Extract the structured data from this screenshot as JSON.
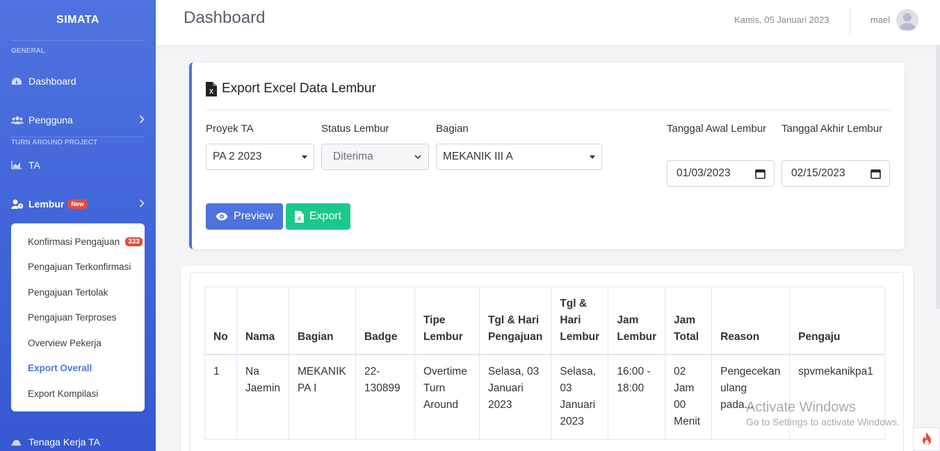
{
  "sidebar": {
    "brand": "SIMATA",
    "sections": {
      "general": "GENERAL",
      "tap": "TURN AROUND PROJECT"
    },
    "items": {
      "dashboard": "Dashboard",
      "pengguna": "Pengguna",
      "ta": "TA",
      "lembur": "Lembur",
      "lembur_badge": "New",
      "tenaga_kerja": "Tenaga Kerja TA"
    },
    "submenu": [
      {
        "label": "Konfirmasi Pengajuan",
        "badge": "333"
      },
      {
        "label": "Pengajuan Terkonfirmasi"
      },
      {
        "label": "Pengajuan Tertolak"
      },
      {
        "label": "Pengajuan Terproses"
      },
      {
        "label": "Overview Pekerja"
      },
      {
        "label": "Export Overall",
        "active": true
      },
      {
        "label": "Export Kompilasi"
      }
    ]
  },
  "topbar": {
    "title": "Dashboard",
    "date": "Kamis, 05 Januari 2023",
    "user": "mael"
  },
  "export_form": {
    "title": "Export Excel Data Lembur",
    "proyek_label": "Proyek TA",
    "proyek_value": "PA 2 2023",
    "status_label": "Status Lembur",
    "status_value": "Diterima",
    "bagian_label": "Bagian",
    "bagian_value": "MEKANIK III A",
    "tgl_awal_label": "Tanggal Awal Lembur",
    "tgl_awal_value": "01/03/2023",
    "tgl_akhir_label": "Tanggal Akhir Lembur",
    "tgl_akhir_value": "02/15/2023",
    "preview_label": "Preview",
    "export_label": "Export"
  },
  "table": {
    "headers": [
      "No",
      "Nama",
      "Bagian",
      "Badge",
      "Tipe Lembur",
      "Tgl & Hari Pengajuan",
      "Tgl & Hari Lembur",
      "Jam Lembur",
      "Jam Total",
      "Reason",
      "Pengaju"
    ],
    "rows": [
      [
        "1",
        "Na Jaemin",
        "MEKANIK PA I",
        "22-130899",
        "Overtime Turn Around",
        "Selasa, 03 Januari 2023",
        "Selasa, 03 Januari 2023",
        "16:00 - 18:00",
        "02 Jam 00 Menit",
        "Pengecekan ulang pada...",
        "spvmekanikpa1"
      ]
    ]
  },
  "watermark": {
    "line1": "Activate Windows",
    "line2": "Go to Settings to activate Windows."
  },
  "colors": {
    "primary": "#4e73df",
    "success": "#1cc88a",
    "danger": "#e74a3b"
  }
}
